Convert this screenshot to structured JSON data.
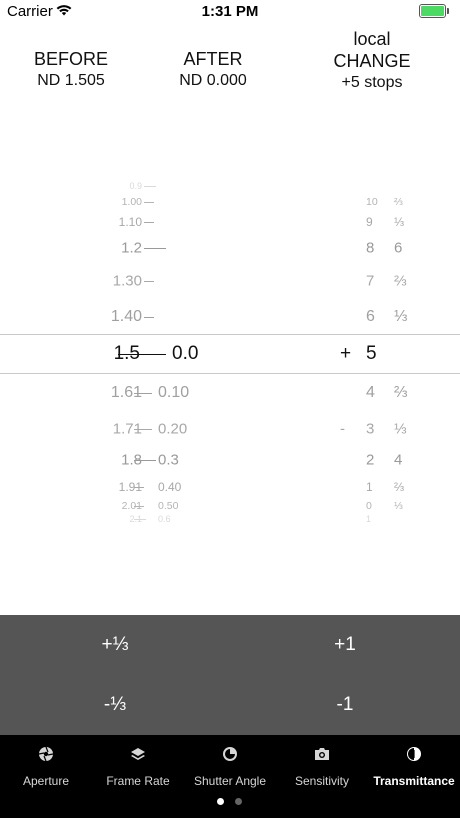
{
  "status_bar": {
    "carrier": "Carrier",
    "time": "1:31 PM"
  },
  "header": {
    "before": {
      "label": "BEFORE",
      "value": "ND 1.505"
    },
    "after": {
      "label": "AFTER",
      "value": "ND 0.000"
    },
    "change": {
      "top_label": "local",
      "label": "CHANGE",
      "value": "+5 stops"
    }
  },
  "picker": {
    "rows": [
      {
        "nd": "0.9",
        "nd2": "",
        "sign": "",
        "stop": "",
        "frac": ""
      },
      {
        "nd": "1.00",
        "nd2": "",
        "sign": "",
        "stop": "10",
        "frac": "⅔"
      },
      {
        "nd": "1.10",
        "nd2": "",
        "sign": "",
        "stop": "9",
        "frac": "⅓"
      },
      {
        "nd": "1.2",
        "nd2": "",
        "sign": "",
        "stop": "8",
        "frac": "6"
      },
      {
        "nd": "1.30",
        "nd2": "",
        "sign": "",
        "stop": "7",
        "frac": "⅔"
      },
      {
        "nd": "1.40",
        "nd2": "",
        "sign": "",
        "stop": "6",
        "frac": "⅓"
      },
      {
        "nd": "1.5",
        "nd2": "0.0",
        "sign": "+",
        "stop": "5",
        "frac": ""
      },
      {
        "nd": "1.61",
        "nd2": "0.10",
        "sign": "",
        "stop": "4",
        "frac": "⅔"
      },
      {
        "nd": "1.71",
        "nd2": "0.20",
        "sign": "-",
        "stop": "3",
        "frac": "⅓"
      },
      {
        "nd": "1.8",
        "nd2": "0.3",
        "sign": "",
        "stop": "2",
        "frac": "4"
      },
      {
        "nd": "1.91",
        "nd2": "0.40",
        "sign": "",
        "stop": "1",
        "frac": "⅔"
      },
      {
        "nd": "2.01",
        "nd2": "0.50",
        "sign": "",
        "stop": "0",
        "frac": "⅓"
      },
      {
        "nd": "2.1",
        "nd2": "0.6",
        "sign": "",
        "stop": "1",
        "frac": ""
      }
    ]
  },
  "buttons": {
    "plus_third": "+⅓",
    "plus_one": "+1",
    "minus_third": "-⅓",
    "minus_one": "-1"
  },
  "tabs": {
    "aperture": "Aperture",
    "frame_rate": "Frame Rate",
    "shutter_angle": "Shutter Angle",
    "sensitivity": "Sensitivity",
    "transmittance": "Transmittance"
  },
  "colors": {
    "button_bg": "#555555",
    "tab_bar_bg": "#000000",
    "battery": "#4cd964"
  }
}
